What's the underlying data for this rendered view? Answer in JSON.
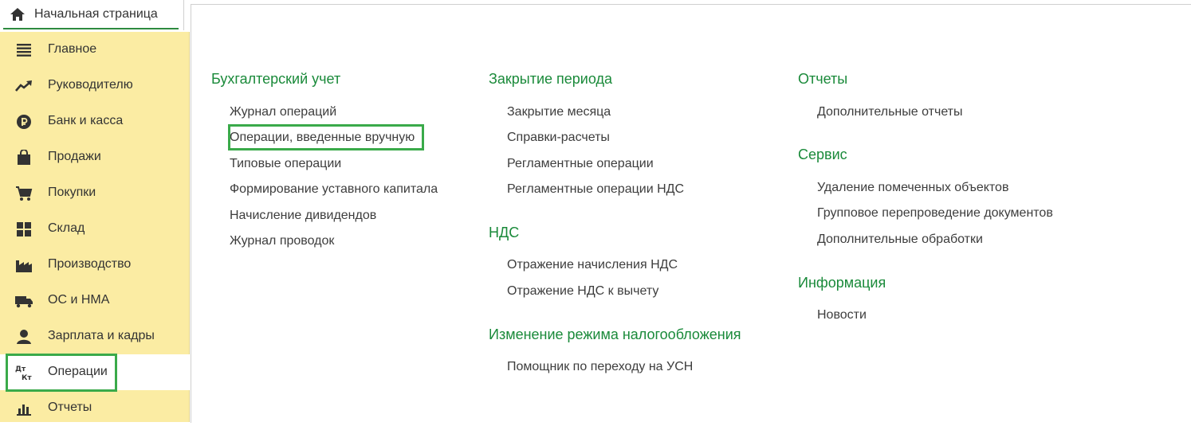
{
  "topbar": {
    "home_tab_label": "Начальная страница",
    "home_icon": "home-icon"
  },
  "sidebar": {
    "items": [
      {
        "label": "Главное",
        "icon": "menu-lines-icon"
      },
      {
        "label": "Руководителю",
        "icon": "trend-up-icon"
      },
      {
        "label": "Банк и касса",
        "icon": "ruble-coin-icon"
      },
      {
        "label": "Продажи",
        "icon": "shopping-bag-icon"
      },
      {
        "label": "Покупки",
        "icon": "cart-icon"
      },
      {
        "label": "Склад",
        "icon": "warehouse-grid-icon"
      },
      {
        "label": "Производство",
        "icon": "factory-icon"
      },
      {
        "label": "ОС и НМА",
        "icon": "truck-icon"
      },
      {
        "label": "Зарплата и кадры",
        "icon": "person-icon"
      },
      {
        "label": "Операции",
        "icon": "dt-kt-icon",
        "active": true,
        "icon_text_top": "Дт",
        "icon_text_bottom": "Кт"
      },
      {
        "label": "Отчеты",
        "icon": "bar-chart-icon"
      }
    ]
  },
  "main": {
    "columns": [
      {
        "sections": [
          {
            "title": "Бухгалтерский учет",
            "links": [
              "Журнал операций",
              "Операции, введенные вручную",
              "Типовые операции",
              "Формирование уставного капитала",
              "Начисление дивидендов",
              "Журнал проводок"
            ]
          }
        ]
      },
      {
        "sections": [
          {
            "title": "Закрытие периода",
            "links": [
              "Закрытие месяца",
              "Справки-расчеты",
              "Регламентные операции",
              "Регламентные операции НДС"
            ]
          },
          {
            "title": "НДС",
            "links": [
              "Отражение начисления НДС",
              "Отражение НДС к вычету"
            ]
          },
          {
            "title": "Изменение режима налогообложения",
            "links": [
              "Помощник по переходу на УСН"
            ]
          }
        ]
      },
      {
        "sections": [
          {
            "title": "Отчеты",
            "links": [
              "Дополнительные отчеты"
            ]
          },
          {
            "title": "Сервис",
            "links": [
              "Удаление помеченных объектов",
              "Групповое перепроведение документов",
              "Дополнительные обработки"
            ]
          },
          {
            "title": "Информация",
            "links": [
              "Новости"
            ]
          }
        ]
      }
    ]
  },
  "colors": {
    "sidebar_bg": "#fbeca3",
    "accent_green": "#1a8a3a",
    "highlight_green": "#3aaa4a"
  }
}
